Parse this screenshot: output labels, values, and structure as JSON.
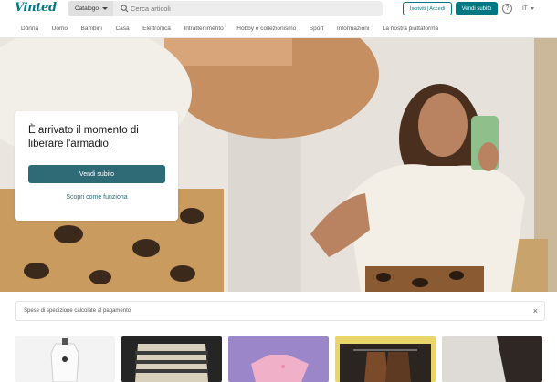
{
  "header": {
    "logo": "Vinted",
    "catalog_label": "Catalogo",
    "search_placeholder": "Cerca articoli",
    "login_label": "Iscriviti | Accedi",
    "sell_label": "Vendi subito",
    "help_label": "?",
    "language": "IT"
  },
  "nav": {
    "items": [
      "Donna",
      "Uomo",
      "Bambini",
      "Casa",
      "Elettronica",
      "Intrattenimento",
      "Hobby e collezionismo",
      "Sport",
      "Informazioni",
      "La nostra piattaforma"
    ]
  },
  "hero": {
    "title": "È arrivato il momento di liberare l'armadio!",
    "sell_button": "Vendi subito",
    "how_link": "Scopri come funziona"
  },
  "shipping_notice": {
    "text": "Spese di spedizione calcolate al pagamento",
    "close_label": "×"
  },
  "products": [
    {
      "name": "product-mannequin"
    },
    {
      "name": "product-striped-top"
    },
    {
      "name": "product-pink-shirt"
    },
    {
      "name": "product-hanging-pants"
    },
    {
      "name": "product-dark-item"
    }
  ],
  "colors": {
    "brand": "#007782",
    "hero_button": "#2e6b77"
  }
}
